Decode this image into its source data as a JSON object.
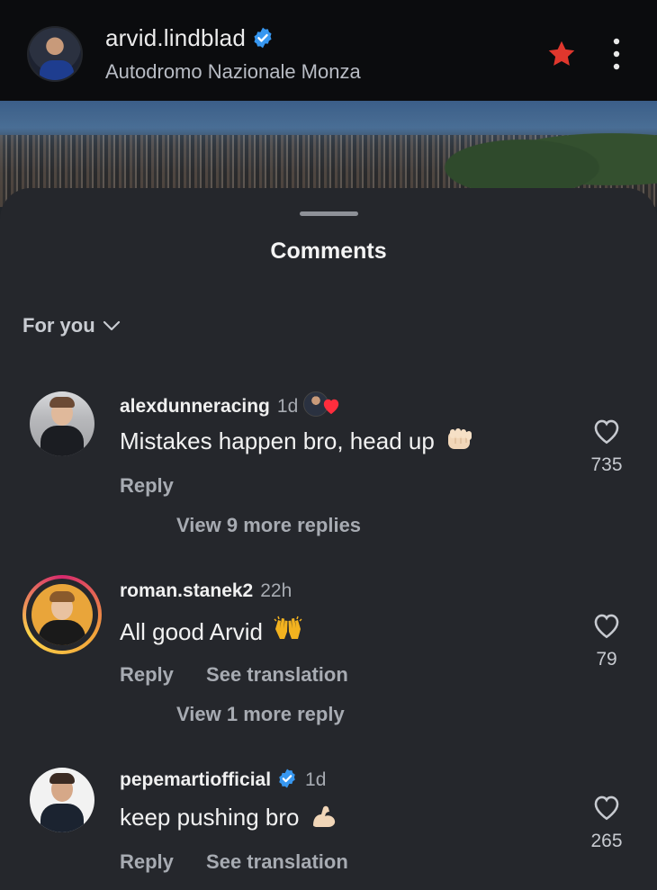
{
  "header": {
    "username": "arvid.lindblad",
    "location": "Autodromo Nazionale Monza",
    "verified": true,
    "star_color": "#e0372d"
  },
  "sheet": {
    "title": "Comments",
    "filter_label": "For you"
  },
  "comments": [
    {
      "username": "alexdunneracing",
      "time": "1d",
      "text": "Mistakes happen bro, head up",
      "emoji": "fist-bump",
      "liked_by_author": true,
      "reply_label": "Reply",
      "likes": "735",
      "view_replies": "View 9 more replies"
    },
    {
      "username": "roman.stanek2",
      "time": "22h",
      "text": "All good Arvid",
      "emoji": "raising-hands",
      "reply_label": "Reply",
      "translation_label": "See translation",
      "likes": "79",
      "view_replies": "View 1 more reply"
    },
    {
      "username": "pepemartiofficial",
      "time": "1d",
      "verified": true,
      "text": "keep pushing bro",
      "emoji": "flexed-biceps",
      "reply_label": "Reply",
      "translation_label": "See translation",
      "likes": "265"
    }
  ],
  "colors": {
    "sheet_bg": "#25272c",
    "verified_blue": "#3797f0",
    "heart_red": "#ff2d3d"
  }
}
